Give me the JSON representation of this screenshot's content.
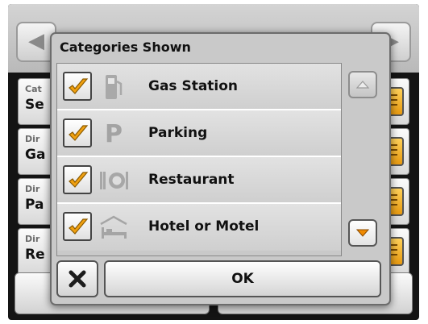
{
  "background": {
    "nav_left_icon": "chevron-left-icon",
    "nav_right_icon": "chevron-right-icon",
    "rows": [
      {
        "label": "Cat",
        "value": "Se"
      },
      {
        "label": "Dir",
        "value": "Ga"
      },
      {
        "label": "Dir",
        "value": "Pa"
      },
      {
        "label": "Dir",
        "value": "Re"
      }
    ]
  },
  "dialog": {
    "title": "Categories Shown",
    "categories": [
      {
        "label": "Gas Station",
        "icon": "gas-pump-icon",
        "checked": true
      },
      {
        "label": "Parking",
        "icon": "parking-icon",
        "icon_text": "P",
        "checked": true
      },
      {
        "label": "Restaurant",
        "icon": "restaurant-icon",
        "checked": true
      },
      {
        "label": "Hotel or Motel",
        "icon": "hotel-bed-icon",
        "checked": true
      }
    ],
    "scroll_up_icon": "triangle-up-icon",
    "scroll_down_icon": "triangle-down-icon",
    "close_icon": "close-icon",
    "ok_label": "OK"
  },
  "colors": {
    "check_accent": "#f0a010",
    "scroll_down_accent": "#f08a00",
    "list_button_accent": "#f5b028"
  }
}
